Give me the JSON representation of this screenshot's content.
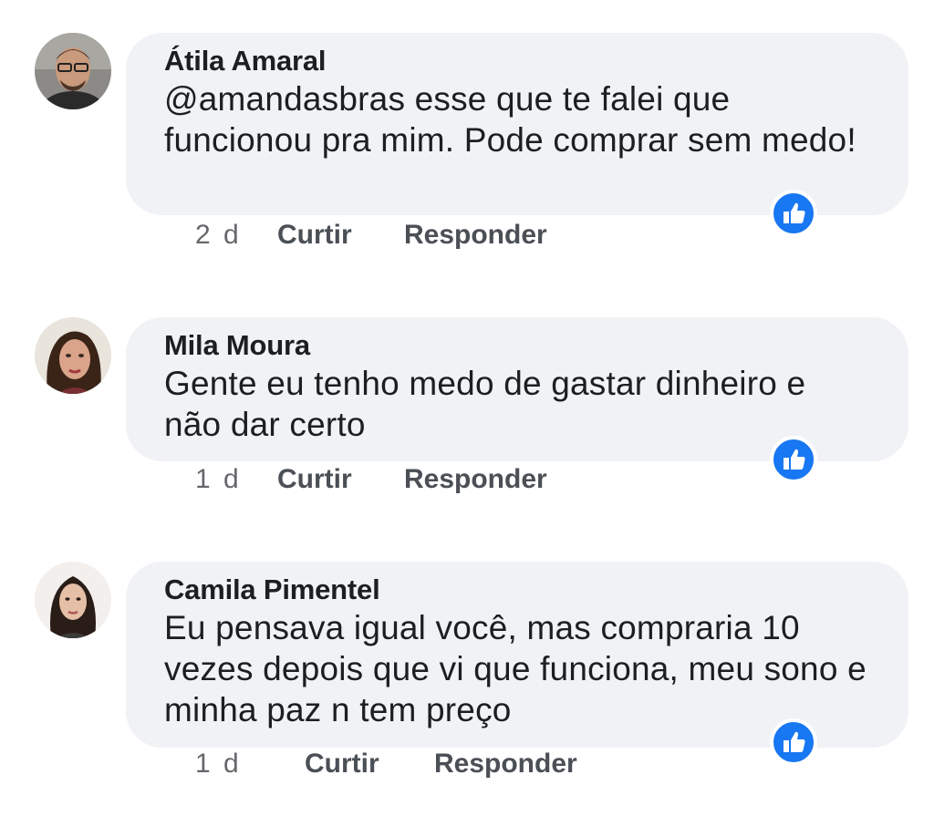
{
  "comments": [
    {
      "author": "Átila Amaral",
      "text": "@amandasbras esse que te falei que funcionou pra mim. Pode comprar sem medo!",
      "time": "2 d",
      "like_label": "Curtir",
      "reply_label": "Responder",
      "reaction_icon": "like-icon"
    },
    {
      "author": "Mila Moura",
      "text": "Gente eu tenho medo de gastar dinheiro e não dar certo",
      "time": "1 d",
      "like_label": "Curtir",
      "reply_label": "Responder",
      "reaction_icon": "like-icon"
    },
    {
      "author": "Camila Pimentel",
      "text": "Eu pensava igual você, mas compraria 10 vezes depois que vi que funciona, meu sono e minha paz n tem preço",
      "time": "1 d",
      "like_label": "Curtir",
      "reply_label": "Responder",
      "reaction_icon": "like-icon"
    }
  ],
  "colors": {
    "bubble": "#f0f2f5",
    "reaction": "#1877f2",
    "meta_text": "#65676b"
  }
}
